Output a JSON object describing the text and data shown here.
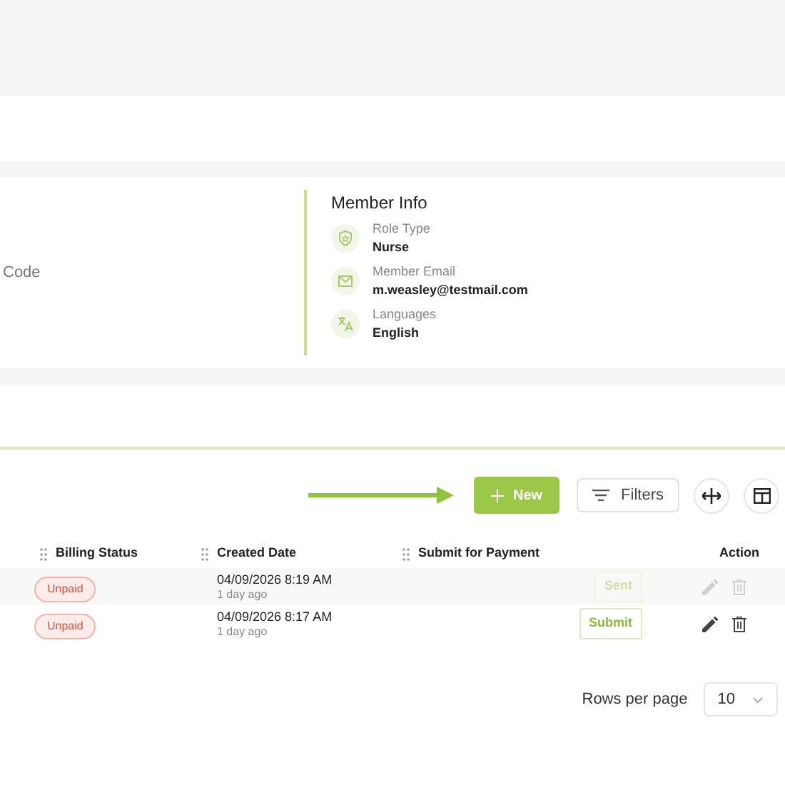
{
  "details": {
    "left_label": "Code",
    "section_title": "Member Info",
    "fields": [
      {
        "kind": "role",
        "label": "Role Type",
        "value": "Nurse"
      },
      {
        "kind": "email",
        "label": "Member Email",
        "value": "m.weasley@testmail.com"
      },
      {
        "kind": "language",
        "label": "Languages",
        "value": "English"
      }
    ]
  },
  "toolbar": {
    "new_button": "New",
    "filters_button": "Filters"
  },
  "table": {
    "columns": [
      "Billing Status",
      "Created Date",
      "Submit for Payment",
      "Action"
    ],
    "rows": [
      {
        "billing_status": "Unpaid",
        "created_date": "04/09/2026 8:19 AM",
        "created_ago": "1 day ago",
        "payment_button": "Sent",
        "disabled": true
      },
      {
        "billing_status": "Unpaid",
        "created_date": "04/09/2026 8:17 AM",
        "created_ago": "1 day ago",
        "payment_button": "Submit",
        "disabled": false
      }
    ]
  },
  "pagination": {
    "label": "Rows per page",
    "value": "10"
  }
}
